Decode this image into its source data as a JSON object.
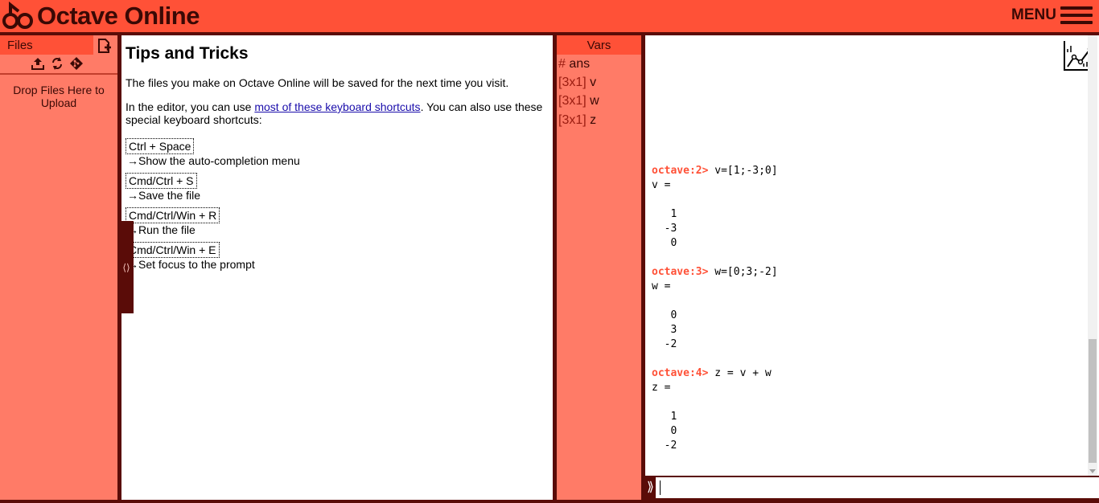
{
  "app": {
    "brand": "Octave Online",
    "menu_label": "MENU"
  },
  "files": {
    "title": "Files",
    "drop_text": "Drop Files Here to Upload",
    "icons": [
      "new-file-icon",
      "upload-icon",
      "refresh-icon",
      "git-icon"
    ]
  },
  "editor": {
    "title": "Tips and Tricks",
    "p1": "The files you make on Octave Online will be saved for the next time you visit.",
    "p2_before": "In the editor, you can use ",
    "p2_link": "most of these keyboard shortcuts",
    "p2_after": ". You can also use these special keyboard shortcuts:",
    "shortcuts": [
      {
        "keys": "Ctrl + Space",
        "desc": "Show the auto-completion menu"
      },
      {
        "keys": "Cmd/Ctrl + S",
        "desc": "Save the file"
      },
      {
        "keys": "Cmd/Ctrl/Win + R",
        "desc": "Run the file"
      },
      {
        "keys": "Cmd/Ctrl/Win + E",
        "desc": "Set focus to the prompt"
      }
    ],
    "arrow": "→"
  },
  "handles": {
    "glyph": "⟨⟩"
  },
  "vars": {
    "title": "Vars",
    "items": [
      {
        "type": "#",
        "name": "ans"
      },
      {
        "type": "[3x1]",
        "name": "v"
      },
      {
        "type": "[3x1]",
        "name": "w"
      },
      {
        "type": "[3x1]",
        "name": "z"
      }
    ]
  },
  "console": {
    "blocks": [
      {
        "prompt": "octave:2>",
        "cmd": " v=[1;-3;0]",
        "lines": [
          "v =",
          "",
          "   1",
          "  -3",
          "   0"
        ]
      },
      {
        "prompt": "octave:3>",
        "cmd": " w=[0;3;-2]",
        "lines": [
          "w =",
          "",
          "   0",
          "   3",
          "  -2"
        ]
      },
      {
        "prompt": "octave:4>",
        "cmd": " z = v + w",
        "lines": [
          "z =",
          "",
          "   1",
          "   0",
          "  -2"
        ]
      }
    ],
    "input_prompt": "⟫",
    "input_value": ""
  },
  "colors": {
    "accent": "#ff5137",
    "panel": "#ff7b67",
    "dark": "#5a0c08"
  }
}
